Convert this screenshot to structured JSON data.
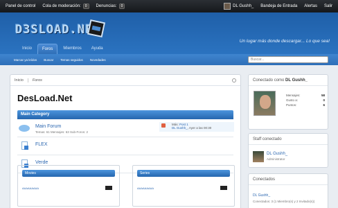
{
  "topbar": {
    "panel": "Panel de control",
    "moderation": "Cola de moderación:",
    "moderation_count": "0",
    "reports": "Denuncias:",
    "reports_count": "0",
    "username": "DL Gushh_",
    "inbox": "Bandeja de Entrada",
    "alerts": "Alertas",
    "logout": "Salir"
  },
  "header": {
    "logo_text": "D3SLOAD.NET",
    "slogan": "Un lugar más donde descargar... Lo que sea!"
  },
  "nav": {
    "tabs": [
      "Inicio",
      "Foros",
      "Miembros",
      "Ayuda"
    ],
    "active": "Foros"
  },
  "subnav": {
    "links": [
      "Marcar ya leídos",
      "Buscar",
      "Temas seguidos",
      "Novedades"
    ],
    "search_placeholder": "Buscar..."
  },
  "breadcrumb": [
    "Inicio",
    "Foros"
  ],
  "page_title": "DesLoad.Net",
  "category": {
    "name": "Main Category",
    "forums": [
      {
        "name": "Main Forum",
        "stats": "Temas: 61 Mensajes: 63 Sub-Foros: 2",
        "last_title_prefix": "Más:",
        "last_title": "Post 1",
        "last_user": "DL Gushh_",
        "last_time": ", Ayer a las 00:30"
      },
      {
        "name": "FLEX"
      },
      {
        "name": "Verde"
      }
    ]
  },
  "subforums": [
    {
      "title": "Movies",
      "row": "AAAAAAAAA"
    },
    {
      "title": "Series",
      "row": "AAAAAAAAA"
    }
  ],
  "sidebar": {
    "logged_label": "Conectado como",
    "logged_user": "DL Gushh_",
    "stats": [
      {
        "label": "Mensajes:",
        "value": "58"
      },
      {
        "label": "Gusto a:",
        "value": "0"
      },
      {
        "label": "Puntos:",
        "value": "6"
      }
    ],
    "staff_title": "Staff conectado",
    "staff_user": "DL Gushh_",
    "staff_role": "Administrator",
    "online_title": "Conectados",
    "online_user": "DL Gushh_",
    "online_count": "Conectados: 3 (1 Miembro(s) y 2 Invitado(s))"
  },
  "colors": {
    "header_blue": "#2b73c0",
    "link_blue": "#2a66b0",
    "topbar": "#1d2024"
  }
}
